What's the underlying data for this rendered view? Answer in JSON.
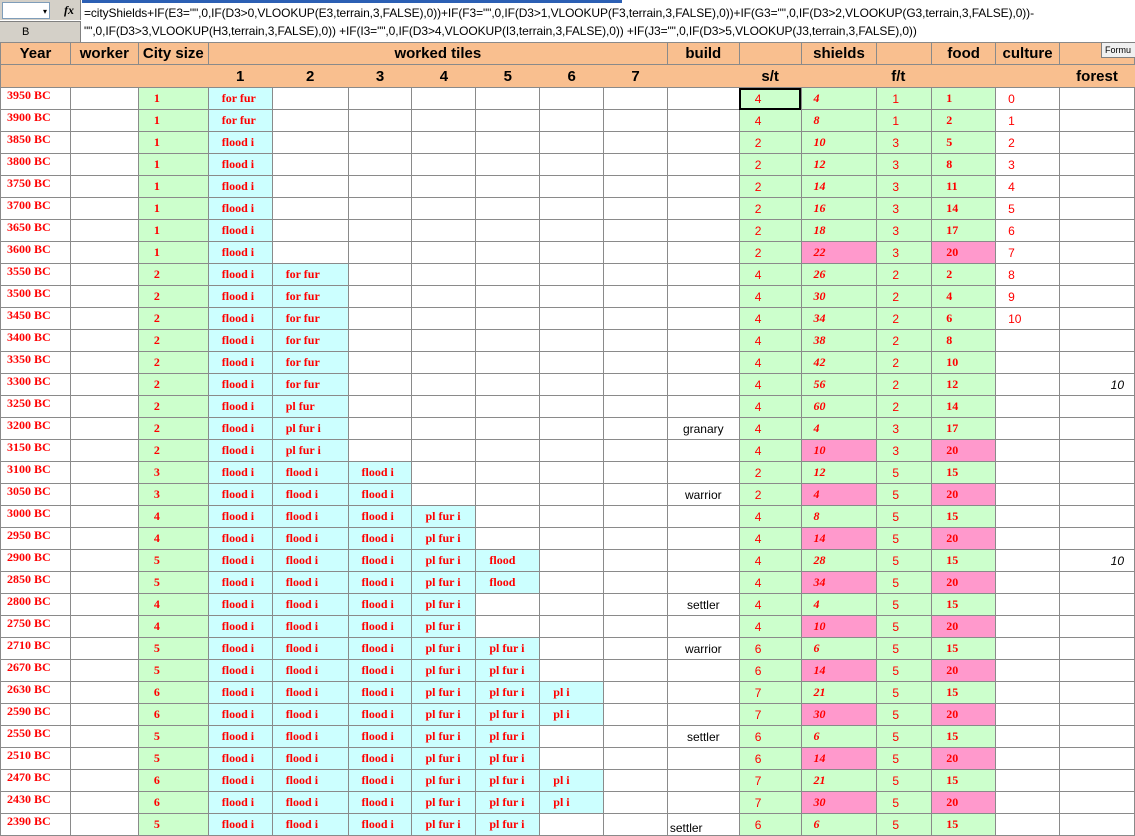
{
  "name_box": "",
  "col_label": "B",
  "formula": {
    "fx": "fx",
    "line1": "=cityShields+IF(E3=\"\",0,IF(D3>0,VLOOKUP(E3,terrain,3,FALSE),0))+IF(F3=\"\",0,IF(D3>1,VLOOKUP(F3,terrain,3,FALSE),0))+IF(G3=\"\",0,IF(D3>2,VLOOKUP(G3,terrain,3,FALSE),0))-",
    "line2": "\"\",0,IF(D3>3,VLOOKUP(H3,terrain,3,FALSE),0)) +IF(I3=\"\",0,IF(D3>4,VLOOKUP(I3,terrain,3,FALSE),0)) +IF(J3=\"\",0,IF(D3>5,VLOOKUP(J3,terrain,3,FALSE),0))"
  },
  "formu_tab": "Formu",
  "headers": {
    "year": "Year",
    "worker": "worker",
    "city_size": "City size",
    "worked_tiles": "worked tiles",
    "build": "build",
    "shields": "shields",
    "food": "food",
    "culture": "culture",
    "tile_numbers": [
      "1",
      "2",
      "3",
      "4",
      "5",
      "6",
      "7"
    ],
    "st": "s/t",
    "ft": "f/t",
    "forest": "forest"
  },
  "rows": [
    {
      "year": "3950 BC",
      "size": "1",
      "tiles": [
        "for fur",
        "",
        "",
        "",
        "",
        "",
        ""
      ],
      "build": "",
      "st": "4",
      "shields": "4",
      "ft": "1",
      "food": "1",
      "culture": "0",
      "forest": "",
      "pink_s": false,
      "pink_f": false
    },
    {
      "year": "3900 BC",
      "size": "1",
      "tiles": [
        "for fur",
        "",
        "",
        "",
        "",
        "",
        ""
      ],
      "build": "",
      "st": "4",
      "shields": "8",
      "ft": "1",
      "food": "2",
      "culture": "1",
      "forest": "",
      "pink_s": false,
      "pink_f": false
    },
    {
      "year": "3850 BC",
      "size": "1",
      "tiles": [
        "flood i",
        "",
        "",
        "",
        "",
        "",
        ""
      ],
      "build": "",
      "st": "2",
      "shields": "10",
      "ft": "3",
      "food": "5",
      "culture": "2",
      "forest": "",
      "pink_s": false,
      "pink_f": false
    },
    {
      "year": "3800 BC",
      "size": "1",
      "tiles": [
        "flood i",
        "",
        "",
        "",
        "",
        "",
        ""
      ],
      "build": "",
      "st": "2",
      "shields": "12",
      "ft": "3",
      "food": "8",
      "culture": "3",
      "forest": "",
      "pink_s": false,
      "pink_f": false
    },
    {
      "year": "3750 BC",
      "size": "1",
      "tiles": [
        "flood i",
        "",
        "",
        "",
        "",
        "",
        ""
      ],
      "build": "",
      "st": "2",
      "shields": "14",
      "ft": "3",
      "food": "11",
      "culture": "4",
      "forest": "",
      "pink_s": false,
      "pink_f": false
    },
    {
      "year": "3700 BC",
      "size": "1",
      "tiles": [
        "flood i",
        "",
        "",
        "",
        "",
        "",
        ""
      ],
      "build": "",
      "st": "2",
      "shields": "16",
      "ft": "3",
      "food": "14",
      "culture": "5",
      "forest": "",
      "pink_s": false,
      "pink_f": false
    },
    {
      "year": "3650 BC",
      "size": "1",
      "tiles": [
        "flood i",
        "",
        "",
        "",
        "",
        "",
        ""
      ],
      "build": "",
      "st": "2",
      "shields": "18",
      "ft": "3",
      "food": "17",
      "culture": "6",
      "forest": "",
      "pink_s": false,
      "pink_f": false
    },
    {
      "year": "3600 BC",
      "size": "1",
      "tiles": [
        "flood i",
        "",
        "",
        "",
        "",
        "",
        ""
      ],
      "build": "",
      "st": "2",
      "shields": "22",
      "ft": "3",
      "food": "20",
      "culture": "7",
      "forest": "",
      "pink_s": true,
      "pink_f": true
    },
    {
      "year": "3550 BC",
      "size": "2",
      "tiles": [
        "flood i",
        "for fur",
        "",
        "",
        "",
        "",
        ""
      ],
      "build": "",
      "st": "4",
      "shields": "26",
      "ft": "2",
      "food": "2",
      "culture": "8",
      "forest": "",
      "pink_s": false,
      "pink_f": false
    },
    {
      "year": "3500 BC",
      "size": "2",
      "tiles": [
        "flood i",
        "for fur",
        "",
        "",
        "",
        "",
        ""
      ],
      "build": "",
      "st": "4",
      "shields": "30",
      "ft": "2",
      "food": "4",
      "culture": "9",
      "forest": "",
      "pink_s": false,
      "pink_f": false
    },
    {
      "year": "3450 BC",
      "size": "2",
      "tiles": [
        "flood i",
        "for fur",
        "",
        "",
        "",
        "",
        ""
      ],
      "build": "",
      "st": "4",
      "shields": "34",
      "ft": "2",
      "food": "6",
      "culture": "10",
      "forest": "",
      "pink_s": false,
      "pink_f": false
    },
    {
      "year": "3400 BC",
      "size": "2",
      "tiles": [
        "flood i",
        "for fur",
        "",
        "",
        "",
        "",
        ""
      ],
      "build": "",
      "st": "4",
      "shields": "38",
      "ft": "2",
      "food": "8",
      "culture": "",
      "forest": "",
      "pink_s": false,
      "pink_f": false
    },
    {
      "year": "3350 BC",
      "size": "2",
      "tiles": [
        "flood i",
        "for fur",
        "",
        "",
        "",
        "",
        ""
      ],
      "build": "",
      "st": "4",
      "shields": "42",
      "ft": "2",
      "food": "10",
      "culture": "",
      "forest": "",
      "pink_s": false,
      "pink_f": false
    },
    {
      "year": "3300 BC",
      "size": "2",
      "tiles": [
        "flood i",
        "for fur",
        "",
        "",
        "",
        "",
        ""
      ],
      "build": "",
      "st": "4",
      "shields": "56",
      "ft": "2",
      "food": "12",
      "culture": "",
      "forest": "10",
      "pink_s": false,
      "pink_f": false
    },
    {
      "year": "3250 BC",
      "size": "2",
      "tiles": [
        "flood i",
        "pl fur",
        "",
        "",
        "",
        "",
        ""
      ],
      "build": "",
      "st": "4",
      "shields": "60",
      "ft": "2",
      "food": "14",
      "culture": "",
      "forest": "",
      "pink_s": false,
      "pink_f": false
    },
    {
      "year": "3200 BC",
      "size": "2",
      "tiles": [
        "flood i",
        "pl fur i",
        "",
        "",
        "",
        "",
        ""
      ],
      "build": "granary",
      "st": "4",
      "shields": "4",
      "ft": "3",
      "food": "17",
      "culture": "",
      "forest": "",
      "pink_s": false,
      "pink_f": false
    },
    {
      "year": "3150 BC",
      "size": "2",
      "tiles": [
        "flood i",
        "pl fur i",
        "",
        "",
        "",
        "",
        ""
      ],
      "build": "",
      "st": "4",
      "shields": "10",
      "ft": "3",
      "food": "20",
      "culture": "",
      "forest": "",
      "pink_s": true,
      "pink_f": true
    },
    {
      "year": "3100 BC",
      "size": "3",
      "tiles": [
        "flood i",
        "flood i",
        "flood i",
        "",
        "",
        "",
        ""
      ],
      "build": "",
      "st": "2",
      "shields": "12",
      "ft": "5",
      "food": "15",
      "culture": "",
      "forest": "",
      "pink_s": false,
      "pink_f": false
    },
    {
      "year": "3050 BC",
      "size": "3",
      "tiles": [
        "flood i",
        "flood i",
        "flood i",
        "",
        "",
        "",
        ""
      ],
      "build": "warrior",
      "st": "2",
      "shields": "4",
      "ft": "5",
      "food": "20",
      "culture": "",
      "forest": "",
      "pink_s": true,
      "pink_f": true
    },
    {
      "year": "3000 BC",
      "size": "4",
      "tiles": [
        "flood i",
        "flood i",
        "flood i",
        "pl fur i",
        "",
        "",
        ""
      ],
      "build": "",
      "st": "4",
      "shields": "8",
      "ft": "5",
      "food": "15",
      "culture": "",
      "forest": "",
      "pink_s": false,
      "pink_f": false
    },
    {
      "year": "2950 BC",
      "size": "4",
      "tiles": [
        "flood i",
        "flood i",
        "flood i",
        "pl fur i",
        "",
        "",
        ""
      ],
      "build": "",
      "st": "4",
      "shields": "14",
      "ft": "5",
      "food": "20",
      "culture": "",
      "forest": "",
      "pink_s": true,
      "pink_f": true
    },
    {
      "year": "2900 BC",
      "size": "5",
      "tiles": [
        "flood i",
        "flood i",
        "flood i",
        "pl fur i",
        "flood",
        "",
        ""
      ],
      "build": "",
      "st": "4",
      "shields": "28",
      "ft": "5",
      "food": "15",
      "culture": "",
      "forest": "10",
      "pink_s": false,
      "pink_f": false
    },
    {
      "year": "2850 BC",
      "size": "5",
      "tiles": [
        "flood i",
        "flood i",
        "flood i",
        "pl fur i",
        "flood",
        "",
        ""
      ],
      "build": "",
      "st": "4",
      "shields": "34",
      "ft": "5",
      "food": "20",
      "culture": "",
      "forest": "",
      "pink_s": true,
      "pink_f": true
    },
    {
      "year": "2800 BC",
      "size": "4",
      "tiles": [
        "flood i",
        "flood i",
        "flood i",
        "pl fur i",
        "",
        "",
        ""
      ],
      "build": "settler",
      "st": "4",
      "shields": "4",
      "ft": "5",
      "food": "15",
      "culture": "",
      "forest": "",
      "pink_s": false,
      "pink_f": false
    },
    {
      "year": "2750 BC",
      "size": "4",
      "tiles": [
        "flood i",
        "flood i",
        "flood i",
        "pl fur i",
        "",
        "",
        ""
      ],
      "build": "",
      "st": "4",
      "shields": "10",
      "ft": "5",
      "food": "20",
      "culture": "",
      "forest": "",
      "pink_s": true,
      "pink_f": true
    },
    {
      "year": "2710 BC",
      "size": "5",
      "tiles": [
        "flood i",
        "flood i",
        "flood i",
        "pl fur i",
        "pl fur i",
        "",
        ""
      ],
      "build": "warrior",
      "st": "6",
      "shields": "6",
      "ft": "5",
      "food": "15",
      "culture": "",
      "forest": "",
      "pink_s": false,
      "pink_f": false
    },
    {
      "year": "2670 BC",
      "size": "5",
      "tiles": [
        "flood i",
        "flood i",
        "flood i",
        "pl fur i",
        "pl fur i",
        "",
        ""
      ],
      "build": "",
      "st": "6",
      "shields": "14",
      "ft": "5",
      "food": "20",
      "culture": "",
      "forest": "",
      "pink_s": true,
      "pink_f": true
    },
    {
      "year": "2630 BC",
      "size": "6",
      "tiles": [
        "flood i",
        "flood i",
        "flood i",
        "pl fur i",
        "pl fur i",
        "pl i",
        ""
      ],
      "build": "",
      "st": "7",
      "shields": "21",
      "ft": "5",
      "food": "15",
      "culture": "",
      "forest": "",
      "pink_s": false,
      "pink_f": false
    },
    {
      "year": "2590 BC",
      "size": "6",
      "tiles": [
        "flood i",
        "flood i",
        "flood i",
        "pl fur i",
        "pl fur i",
        "pl i",
        ""
      ],
      "build": "",
      "st": "7",
      "shields": "30",
      "ft": "5",
      "food": "20",
      "culture": "",
      "forest": "",
      "pink_s": true,
      "pink_f": true
    },
    {
      "year": "2550 BC",
      "size": "5",
      "tiles": [
        "flood i",
        "flood i",
        "flood i",
        "pl fur i",
        "pl fur i",
        "",
        ""
      ],
      "build": "settler",
      "st": "6",
      "shields": "6",
      "ft": "5",
      "food": "15",
      "culture": "",
      "forest": "",
      "pink_s": false,
      "pink_f": false
    },
    {
      "year": "2510 BC",
      "size": "5",
      "tiles": [
        "flood i",
        "flood i",
        "flood i",
        "pl fur i",
        "pl fur i",
        "",
        ""
      ],
      "build": "",
      "st": "6",
      "shields": "14",
      "ft": "5",
      "food": "20",
      "culture": "",
      "forest": "",
      "pink_s": true,
      "pink_f": true
    },
    {
      "year": "2470 BC",
      "size": "6",
      "tiles": [
        "flood i",
        "flood i",
        "flood i",
        "pl fur i",
        "pl fur i",
        "pl i",
        ""
      ],
      "build": "",
      "st": "7",
      "shields": "21",
      "ft": "5",
      "food": "15",
      "culture": "",
      "forest": "",
      "pink_s": false,
      "pink_f": false
    },
    {
      "year": "2430 BC",
      "size": "6",
      "tiles": [
        "flood i",
        "flood i",
        "flood i",
        "pl fur i",
        "pl fur i",
        "pl i",
        ""
      ],
      "build": "",
      "st": "7",
      "shields": "30",
      "ft": "5",
      "food": "20",
      "culture": "",
      "forest": "",
      "pink_s": true,
      "pink_f": true
    },
    {
      "year": "2390 BC",
      "size": "5",
      "tiles": [
        "flood i",
        "flood i",
        "flood i",
        "pl fur i",
        "pl fur i",
        "",
        ""
      ],
      "build": "settler",
      "st": "6",
      "shields": "6",
      "ft": "5",
      "food": "15",
      "culture": "",
      "forest": "",
      "pink_s": false,
      "pink_f": false
    }
  ]
}
